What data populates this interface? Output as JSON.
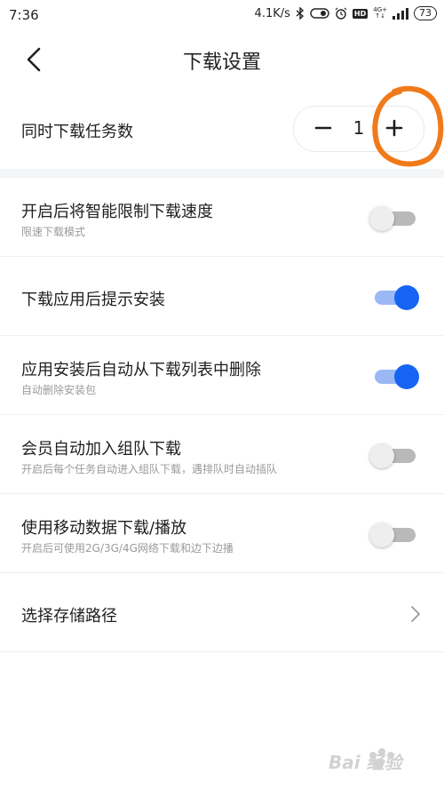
{
  "status_bar": {
    "time": "7:36",
    "net_speed": "4.1K/s",
    "net_type": "4G+",
    "battery": "73"
  },
  "header": {
    "title": "下载设置",
    "back_icon": "chevron-left-icon"
  },
  "concurrent_downloads": {
    "label": "同时下载任务数",
    "value": "1",
    "minus_icon": "minus-icon",
    "plus_icon": "plus-icon",
    "annotation_color": "#f07a1a"
  },
  "settings": [
    {
      "title": "开启后将智能限制下载速度",
      "subtitle": "限速下载模式",
      "enabled": false
    },
    {
      "title": "下载应用后提示安装",
      "subtitle": "",
      "enabled": true
    },
    {
      "title": "应用安装后自动从下载列表中删除",
      "subtitle": "自动删除安装包",
      "enabled": true
    },
    {
      "title": "会员自动加入组队下载",
      "subtitle": "开启后每个任务自动进入组队下载，遇排队时自动插队",
      "enabled": false
    },
    {
      "title": "使用移动数据下载/播放",
      "subtitle": "开启后可使用2G/3G/4G网络下载和边下边播",
      "enabled": false
    }
  ],
  "storage_path": {
    "label": "选择存储路径",
    "chevron_icon": "chevron-right-icon"
  },
  "watermark": {
    "logo": "baidu-jingyan-watermark",
    "text": "Bai 经验"
  },
  "colors": {
    "accent": "#1665f2",
    "toggle_on_track": "#9bb8f5",
    "toggle_off_track": "#b9b9b9",
    "section_gap": "#f4f5f7"
  }
}
